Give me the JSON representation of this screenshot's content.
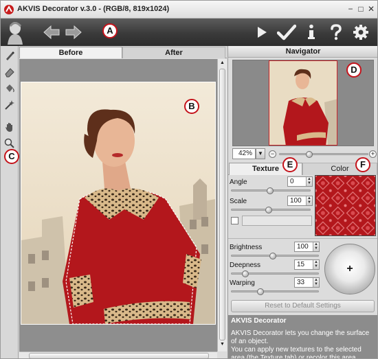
{
  "window": {
    "title": "AKVIS Decorator v.3.0 - (RGB/8, 819x1024)",
    "controls": [
      "−",
      "□",
      "✕"
    ]
  },
  "toolbar": {
    "back_icon": "arrow-left-icon",
    "forward_icon": "arrow-right-icon",
    "run_icon": "play-icon",
    "apply_icon": "checkmark-icon",
    "info_icon": "info-icon",
    "help_icon": "question-icon",
    "settings_icon": "gear-icon"
  },
  "tools": [
    "brush-icon",
    "eraser-icon",
    "bucket-icon",
    "magic-wand-icon",
    "hand-icon",
    "zoom-icon"
  ],
  "canvas": {
    "tabs": [
      "Before",
      "After"
    ],
    "active_tab": "Before"
  },
  "navigator": {
    "title": "Navigator",
    "zoom_value": "42%",
    "zoom_level": 0.42
  },
  "texture_panel": {
    "tabs": [
      "Texture",
      "Color"
    ],
    "active_tab": "Texture",
    "angle": {
      "label": "Angle",
      "value": "0"
    },
    "scale": {
      "label": "Scale",
      "value": "100"
    }
  },
  "adjust": {
    "brightness": {
      "label": "Brightness",
      "value": "100"
    },
    "deepness": {
      "label": "Deepness",
      "value": "15"
    },
    "warping": {
      "label": "Warping",
      "value": "33"
    }
  },
  "reset_label": "Reset to Default Settings",
  "help": {
    "title": "AKVIS Decorator",
    "paragraph1": "AKVIS Decorator lets you change the surface of an object.",
    "paragraph2": "You can apply new textures to the selected area (the Texture tab) or recolor this area (Color tab)."
  },
  "callouts": [
    "A",
    "B",
    "C",
    "D",
    "E",
    "F"
  ],
  "colors": {
    "callout_ring": "#c4131b",
    "dress_red": "#b3171c",
    "toolbar_dark": "#3a3a3a"
  }
}
